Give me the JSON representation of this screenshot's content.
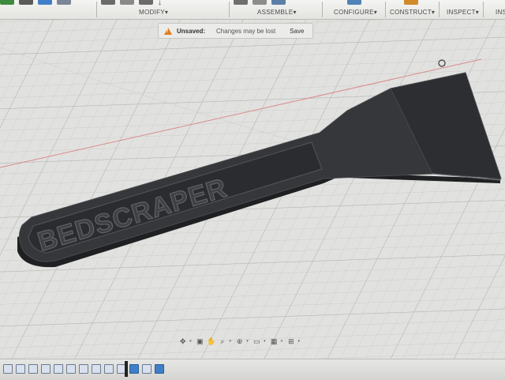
{
  "toolbar": {
    "groups": [
      {
        "label": "MODIFY",
        "name": "modify"
      },
      {
        "label": "ASSEMBLE",
        "name": "assemble"
      },
      {
        "label": "CONFIGURE",
        "name": "configure"
      },
      {
        "label": "CONSTRUCT",
        "name": "construct"
      },
      {
        "label": "INSPECT",
        "name": "inspect"
      },
      {
        "label": "INS",
        "name": "insert"
      }
    ],
    "dropdown_glyph": "▾"
  },
  "banner": {
    "label": "Unsaved:",
    "message": "Changes may be lost",
    "save_label": "Save",
    "icon": "warning-icon"
  },
  "model": {
    "engraved_text": "BEDSCRAPER",
    "body_color": "#2f3032",
    "face_color": "#3b3c3f"
  },
  "navbar": {
    "icons": [
      "orbit-icon",
      "pan-icon",
      "zoom-icon",
      "fit-icon",
      "display-settings-icon",
      "grid-icon",
      "viewports-icon"
    ]
  },
  "timeline": {
    "item_count": 13,
    "icons": [
      "sketch-icon",
      "extrude-icon",
      "body-icon"
    ]
  },
  "colors": {
    "toolbar_bg": "#e9e9e6",
    "grid_line": "#c4c4c2",
    "accent_blue": "#3f7fc7",
    "warning_orange": "#e07a1c"
  }
}
